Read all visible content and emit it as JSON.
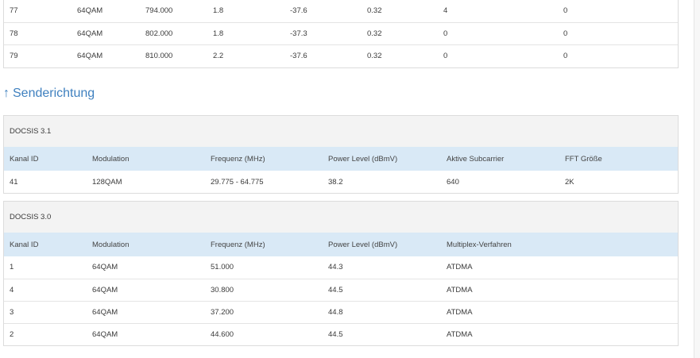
{
  "downstream_tail": {
    "rows": [
      [
        "77",
        "64QAM",
        "794.000",
        "1.8",
        "-37.6",
        "0.32",
        "4",
        "0"
      ],
      [
        "78",
        "64QAM",
        "802.000",
        "1.8",
        "-37.3",
        "0.32",
        "0",
        "0"
      ],
      [
        "79",
        "64QAM",
        "810.000",
        "2.2",
        "-37.6",
        "0.32",
        "0",
        "0"
      ]
    ]
  },
  "upstream": {
    "arrow_icon": "↑",
    "heading": "Senderichtung",
    "docsis31": {
      "title": "DOCSIS 3.1",
      "columns": [
        "Kanal ID",
        "Modulation",
        "Frequenz (MHz)",
        "Power Level (dBmV)",
        "Aktive Subcarrier",
        "FFT Größe"
      ],
      "rows": [
        [
          "41",
          "128QAM",
          "29.775 - 64.775",
          "38.2",
          "640",
          "2K"
        ]
      ]
    },
    "docsis30": {
      "title": "DOCSIS 3.0",
      "columns": [
        "Kanal ID",
        "Modulation",
        "Frequenz (MHz)",
        "Power Level (dBmV)",
        "Multiplex-Verfahren"
      ],
      "rows": [
        [
          "1",
          "64QAM",
          "51.000",
          "44.3",
          "ATDMA"
        ],
        [
          "4",
          "64QAM",
          "30.800",
          "44.5",
          "ATDMA"
        ],
        [
          "3",
          "64QAM",
          "37.200",
          "44.8",
          "ATDMA"
        ],
        [
          "2",
          "64QAM",
          "44.600",
          "44.5",
          "ATDMA"
        ]
      ]
    }
  }
}
